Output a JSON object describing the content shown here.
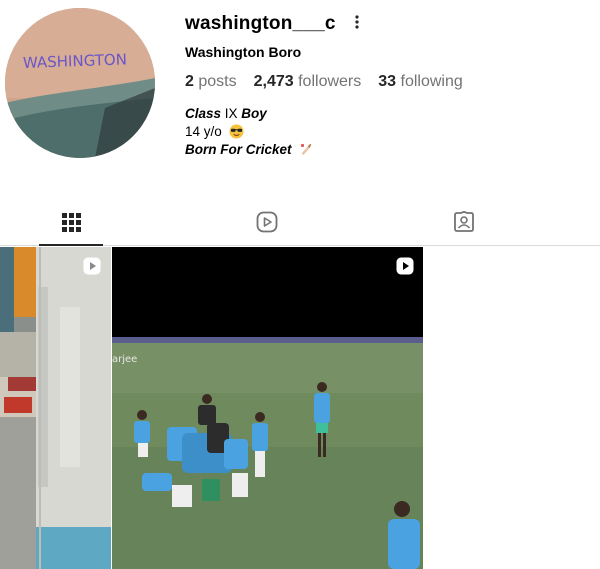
{
  "profile": {
    "username": "washington___c",
    "full_name": "Washington Boro",
    "avatar_text": "WASHINGTON",
    "stats": {
      "posts_count": "2",
      "posts_label": "posts",
      "followers_count": "2,473",
      "followers_label": "followers",
      "following_count": "33",
      "following_label": "following"
    },
    "bio": {
      "line1_part1": "Class",
      "line1_part2": " IX ",
      "line1_part3": "Boy",
      "line2": "14 y/o",
      "line2_emoji": "sunglasses-face-emoji",
      "line3": "Born For Cricket",
      "line3_emoji": "cricket-bat-emoji"
    }
  },
  "tabs": [
    {
      "name": "posts",
      "icon": "grid-icon",
      "active": true
    },
    {
      "name": "reels",
      "icon": "reels-icon",
      "active": false
    },
    {
      "name": "tagged",
      "icon": "tagged-icon",
      "active": false
    }
  ],
  "posts": [
    {
      "type": "reel",
      "icon": "reel-icon"
    },
    {
      "type": "reel",
      "icon": "reel-icon",
      "watermark": "arjee"
    }
  ],
  "colors": {
    "text": "#262626",
    "secondary_text": "#737373",
    "divider": "#dbdbdb",
    "jersey_blue": "#4aa3e0",
    "field_green": "#6f8a5c"
  }
}
